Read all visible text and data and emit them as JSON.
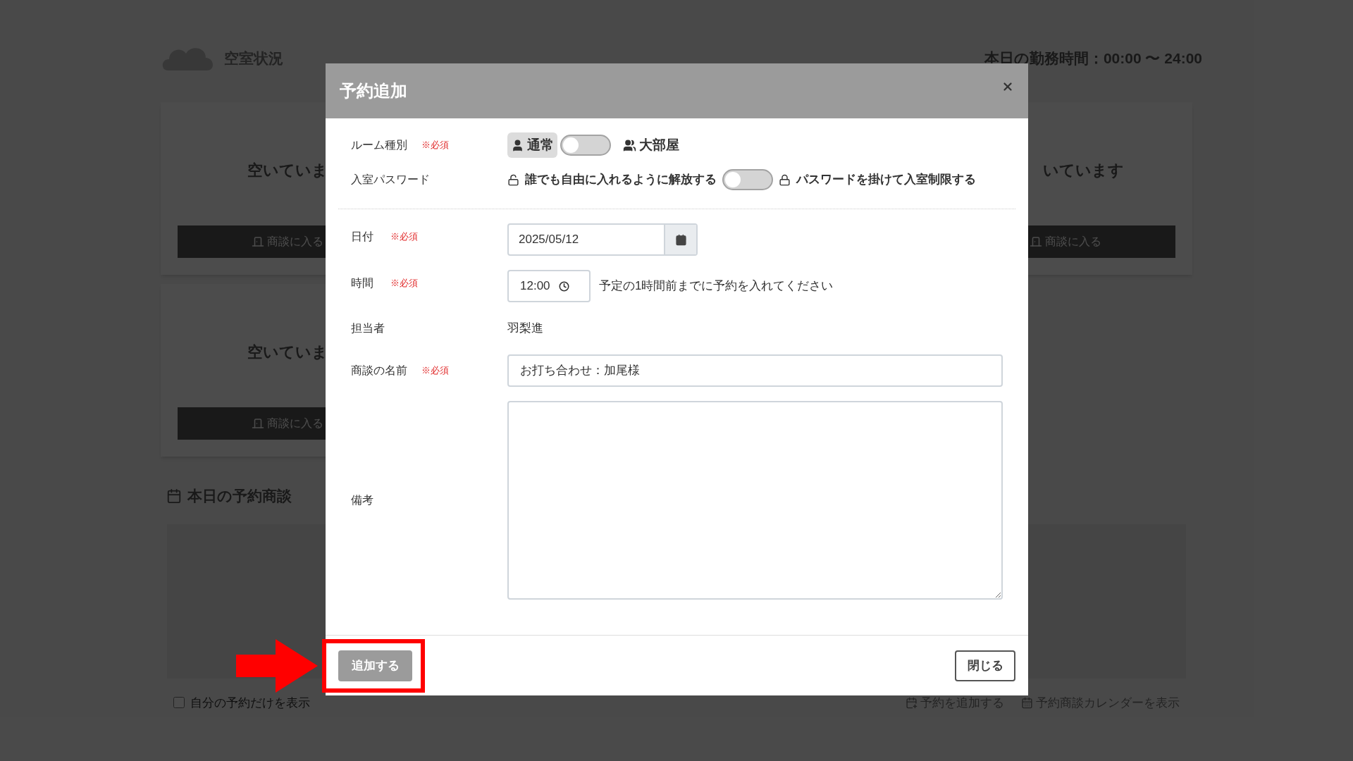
{
  "header": {
    "title": "空室状況",
    "work_hours": "本日の勤務時間：00:00 〜 24:00"
  },
  "rooms": [
    {
      "status": "空いていま",
      "button": "商談に入る"
    },
    {
      "status": "いています",
      "button": "商談に入る"
    },
    {
      "status": "空いていま",
      "button": "商談に入る"
    }
  ],
  "today": {
    "title": "本日の予約商談",
    "own_only": {
      "label": "自分の予約だけを表示",
      "checked": false
    },
    "links": [
      "予約を追加する",
      "予約商談カレンダーを表示"
    ]
  },
  "dialog": {
    "title": "予約追加",
    "room_type": {
      "label": "ルーム種別",
      "required": "※必須",
      "on": false,
      "options": [
        {
          "label": "通常",
          "selected": true
        },
        {
          "label": "大部屋",
          "selected": false
        }
      ]
    },
    "password": {
      "label": "入室パスワード",
      "on": false,
      "off_label": "誰でも自由に入れるように解放する",
      "on_label": "パスワードを掛けて入室制限する"
    },
    "date": {
      "label": "日付",
      "required": "※必須",
      "value": "2025/05/12"
    },
    "time": {
      "label": "時間",
      "required": "※必須",
      "value": "12:00",
      "hint": "予定の1時間前までに予約を入れてください"
    },
    "person": {
      "label": "担当者",
      "value": "羽梨進"
    },
    "name": {
      "label": "商談の名前",
      "required": "※必須",
      "value": "お打ち合わせ：加尾様"
    },
    "notes": {
      "label": "備考"
    },
    "buttons": {
      "submit": "追加する",
      "close": "閉じる"
    }
  }
}
